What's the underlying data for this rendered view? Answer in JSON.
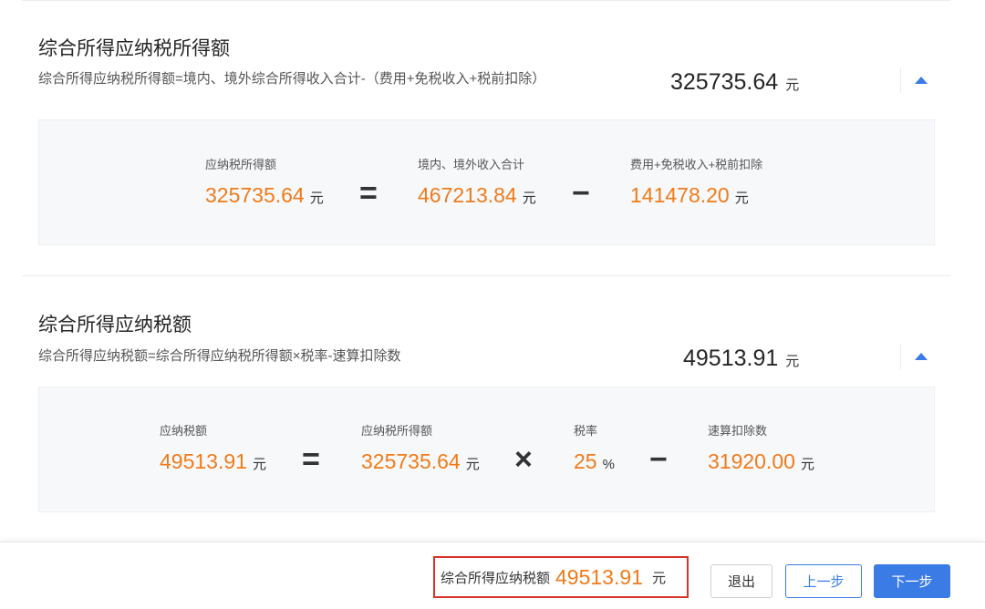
{
  "taxable_income_section": {
    "title": "综合所得应纳税所得额",
    "formula": "综合所得应纳税所得额=境内、境外综合所得收入合计-（费用+免税收入+税前扣除）",
    "total_value": "325735.64",
    "unit": "元",
    "calc": {
      "result_label": "应纳税所得额",
      "result_value": "325735.64",
      "equals": "=",
      "income_label": "境内、境外收入合计",
      "income_value": "467213.84",
      "minus": "−",
      "deduction_label": "费用+免税收入+税前扣除",
      "deduction_value": "141478.20"
    }
  },
  "tax_payable_section": {
    "title": "综合所得应纳税额",
    "formula": "综合所得应纳税额=综合所得应纳税所得额×税率-速算扣除数",
    "total_value": "49513.91",
    "unit": "元",
    "calc": {
      "result_label": "应纳税额",
      "result_value": "49513.91",
      "equals": "=",
      "taxable_label": "应纳税所得额",
      "taxable_value": "325735.64",
      "times": "×",
      "rate_label": "税率",
      "rate_value": "25",
      "rate_unit": "%",
      "minus": "−",
      "quick_deduction_label": "速算扣除数",
      "quick_deduction_value": "31920.00"
    }
  },
  "footer": {
    "total_label": "综合所得应纳税额",
    "total_value": "49513.91",
    "unit": "元",
    "exit_label": "退出",
    "prev_label": "上一步",
    "next_label": "下一步"
  },
  "colors": {
    "accent_blue": "#3b7be6",
    "value_orange": "#f07b1a",
    "highlight_red": "#d8322a"
  },
  "icons": {
    "collapse": "caret-up-icon"
  }
}
